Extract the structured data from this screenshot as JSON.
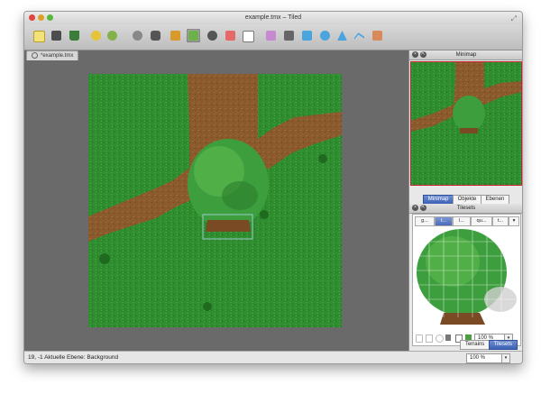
{
  "window": {
    "title": "example.tmx – Tiled"
  },
  "document_tab": {
    "label": "*example.tmx"
  },
  "minimap_panel": {
    "title": "Minimap"
  },
  "side_tabs": [
    {
      "label": "Minimap",
      "selected": true
    },
    {
      "label": "Objekte",
      "selected": false
    },
    {
      "label": "Ebenen",
      "selected": false
    }
  ],
  "tilesets_panel": {
    "title": "Tilesets",
    "tabs": [
      "g...",
      "t...",
      "l...",
      "qu...",
      "t..."
    ],
    "selected_tab": 1,
    "zoom": "100 %"
  },
  "bottom_tabs": [
    {
      "label": "Terrains",
      "selected": false
    },
    {
      "label": "Tilesets",
      "selected": true
    }
  ],
  "status": {
    "text": "19, -1  Aktuelle Ebene: Background",
    "zoom": "100 %"
  },
  "colors": {
    "grass": "#2f8d2f",
    "dirt": "#8a5a2c",
    "canvas_bg": "#6a6a6a",
    "tab_selected": "#3d62b6",
    "minimap_frame": "#c8202a"
  },
  "toolbar_icons": [
    "new-map-icon",
    "open-file-icon",
    "save-icon",
    "undo-icon",
    "redo-icon",
    "random-mode-icon",
    "stamp-brush-icon",
    "terrain-brush-icon",
    "bucket-fill-icon",
    "eraser-icon",
    "rectangle-select-icon",
    "magic-wand-icon",
    "select-same-tile-icon",
    "object-select-icon",
    "insert-rectangle-icon",
    "insert-ellipse-icon",
    "insert-polygon-icon",
    "insert-polyline-icon",
    "insert-tile-icon"
  ]
}
